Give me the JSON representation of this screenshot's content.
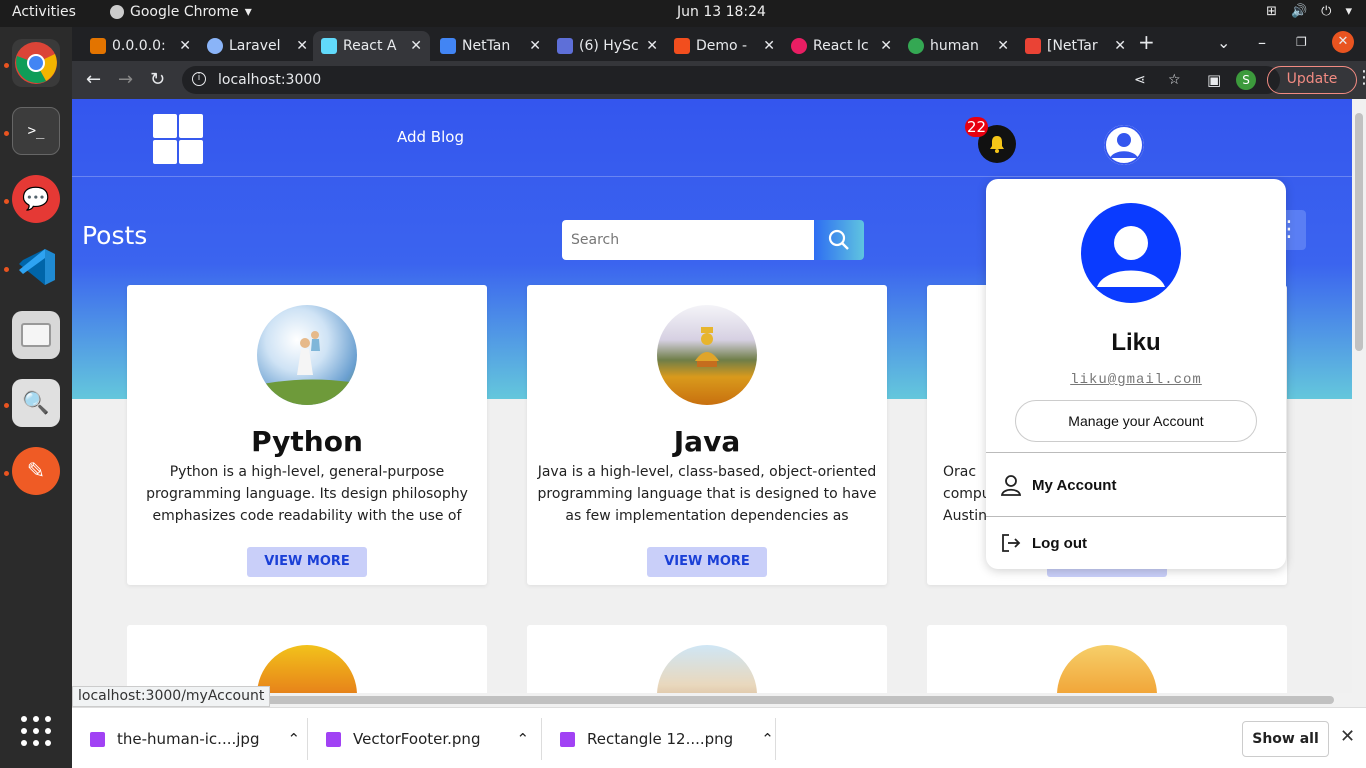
{
  "desktop": {
    "activities": "Activities",
    "app_name": "Google Chrome",
    "clock": "Jun 13  18:24"
  },
  "chrome": {
    "tabs": [
      {
        "label": "0.0.0.0:",
        "color": "#e37400"
      },
      {
        "label": "Laravel",
        "color": "#8ab4f8"
      },
      {
        "label": "React A",
        "color": "#61dafb"
      },
      {
        "label": "NetTan",
        "color": "#4285f4"
      },
      {
        "label": "(6) HySc",
        "color": "#5e6fd8"
      },
      {
        "label": "Demo -",
        "color": "#f24e1e"
      },
      {
        "label": "React Ic",
        "color": "#e91e63"
      },
      {
        "label": "human",
        "color": "#34a853"
      },
      {
        "label": "[NetTar",
        "color": "#ea4335"
      }
    ],
    "url": "localhost:3000",
    "profile_initial": "S",
    "update_label": "Update"
  },
  "page": {
    "nav_add_blog": "Add Blog",
    "notification_count": "22",
    "posts_title": "Posts",
    "search_placeholder": "Search",
    "cards": [
      {
        "title": "Python",
        "desc": "Python is a high-level, general-purpose programming language. Its design philosophy emphasizes code readability with the use of significant indentation via the",
        "button": "VIEW MORE"
      },
      {
        "title": "Java",
        "desc": "Java is a high-level, class-based, object-oriented programming language that is designed to have as few implementation dependencies as possible.",
        "button": "VIEW MORE"
      },
      {
        "title": "",
        "desc": "Orac compu Austin",
        "button": ""
      }
    ]
  },
  "account_menu": {
    "name": "Liku",
    "email": "liku@gmail.com",
    "manage_label": "Manage your Account",
    "my_account_label": "My Account",
    "logout_label": "Log out"
  },
  "status_url": "localhost:3000/myAccount",
  "downloads": {
    "items": [
      "the-human-ic....jpg",
      "VectorFooter.png",
      "Rectangle 12....png"
    ],
    "show_all": "Show all"
  }
}
